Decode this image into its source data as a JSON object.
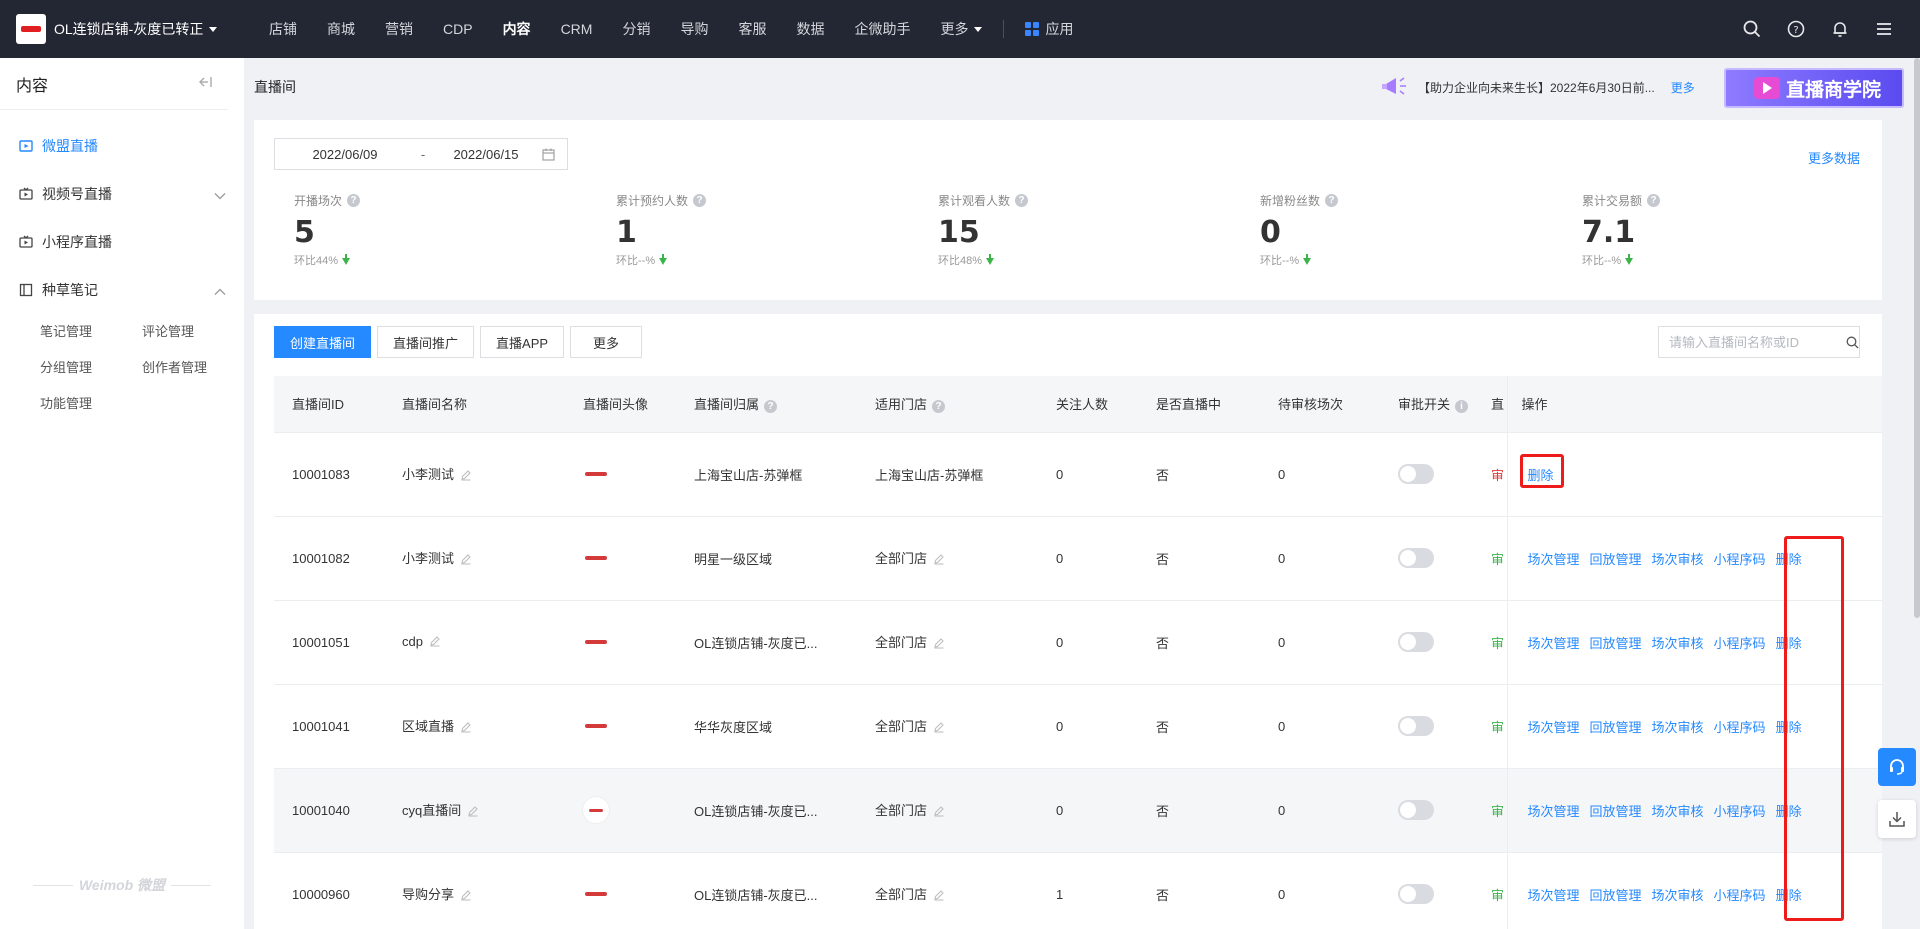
{
  "brand": {
    "name": "OL连锁店铺-灰度已转正"
  },
  "topnav": [
    "店铺",
    "商城",
    "营销",
    "CDP",
    "内容",
    "CRM",
    "分销",
    "导购",
    "客服",
    "数据",
    "企微助手",
    "更多",
    "应用"
  ],
  "sidebar": {
    "title": "内容",
    "items": [
      {
        "label": "微盟直播"
      },
      {
        "label": "视频号直播"
      },
      {
        "label": "小程序直播"
      },
      {
        "label": "种草笔记"
      }
    ],
    "sub_items": [
      "笔记管理",
      "评论管理",
      "分组管理",
      "创作者管理",
      "功能管理"
    ],
    "footer": "Weimob 微盟"
  },
  "page": {
    "title": "直播间",
    "notice": "【助力企业向未来生长】2022年6月30日前...",
    "notice_more": "更多",
    "banner": "直播商学院"
  },
  "stats": {
    "date_start": "2022/06/09",
    "date_sep": "-",
    "date_end": "2022/06/15",
    "more_data": "更多数据",
    "items": [
      {
        "label": "开播场次",
        "value": "5",
        "ratio": "环比44%"
      },
      {
        "label": "累计预约人数",
        "value": "1",
        "ratio": "环比--%"
      },
      {
        "label": "累计观看人数",
        "value": "15",
        "ratio": "环比48%"
      },
      {
        "label": "新增粉丝数",
        "value": "0",
        "ratio": "环比--%"
      },
      {
        "label": "累计交易额",
        "value": "7.1",
        "ratio": "环比--%"
      }
    ]
  },
  "toolbar": {
    "create": "创建直播间",
    "promote": "直播间推广",
    "app": "直播APP",
    "more": "更多",
    "search_placeholder": "请输入直播间名称或ID"
  },
  "table": {
    "headers": [
      "直播间ID",
      "直播间名称",
      "直播间头像",
      "直播间归属",
      "适用门店",
      "关注人数",
      "是否直播中",
      "待审核场次",
      "审批开关",
      "直",
      "操作"
    ],
    "ops": [
      "场次管理",
      "回放管理",
      "场次审核",
      "小程序码",
      "删除"
    ],
    "rows": [
      {
        "id": "10001083",
        "name": "小李测试",
        "owner": "上海宝山店-苏弹框",
        "store": "上海宝山店-苏弹框",
        "followers": "0",
        "live": "否",
        "pending": "0",
        "cut": "审",
        "delete_only": "删除"
      },
      {
        "id": "10001082",
        "name": "小李测试",
        "owner": "明星一级区域",
        "store": "全部门店",
        "followers": "0",
        "live": "否",
        "pending": "0",
        "cut": "审"
      },
      {
        "id": "10001051",
        "name": "cdp",
        "owner": "OL连锁店铺-灰度已...",
        "store": "全部门店",
        "followers": "0",
        "live": "否",
        "pending": "0",
        "cut": "审"
      },
      {
        "id": "10001041",
        "name": "区域直播",
        "owner": "华华灰度区域",
        "store": "全部门店",
        "followers": "0",
        "live": "否",
        "pending": "0",
        "cut": "审"
      },
      {
        "id": "10001040",
        "name": "cyq直播间",
        "owner": "OL连锁店铺-灰度已...",
        "store": "全部门店",
        "followers": "0",
        "live": "否",
        "pending": "0",
        "cut": "审"
      },
      {
        "id": "10000960",
        "name": "导购分享",
        "owner": "OL连锁店铺-灰度已...",
        "store": "全部门店",
        "followers": "1",
        "live": "否",
        "pending": "0",
        "cut": "审"
      }
    ]
  },
  "colors": {
    "accent": "#2589ff",
    "topbar": "#232733",
    "highlight": "#ee1b1b",
    "down": "#3bb54a"
  }
}
